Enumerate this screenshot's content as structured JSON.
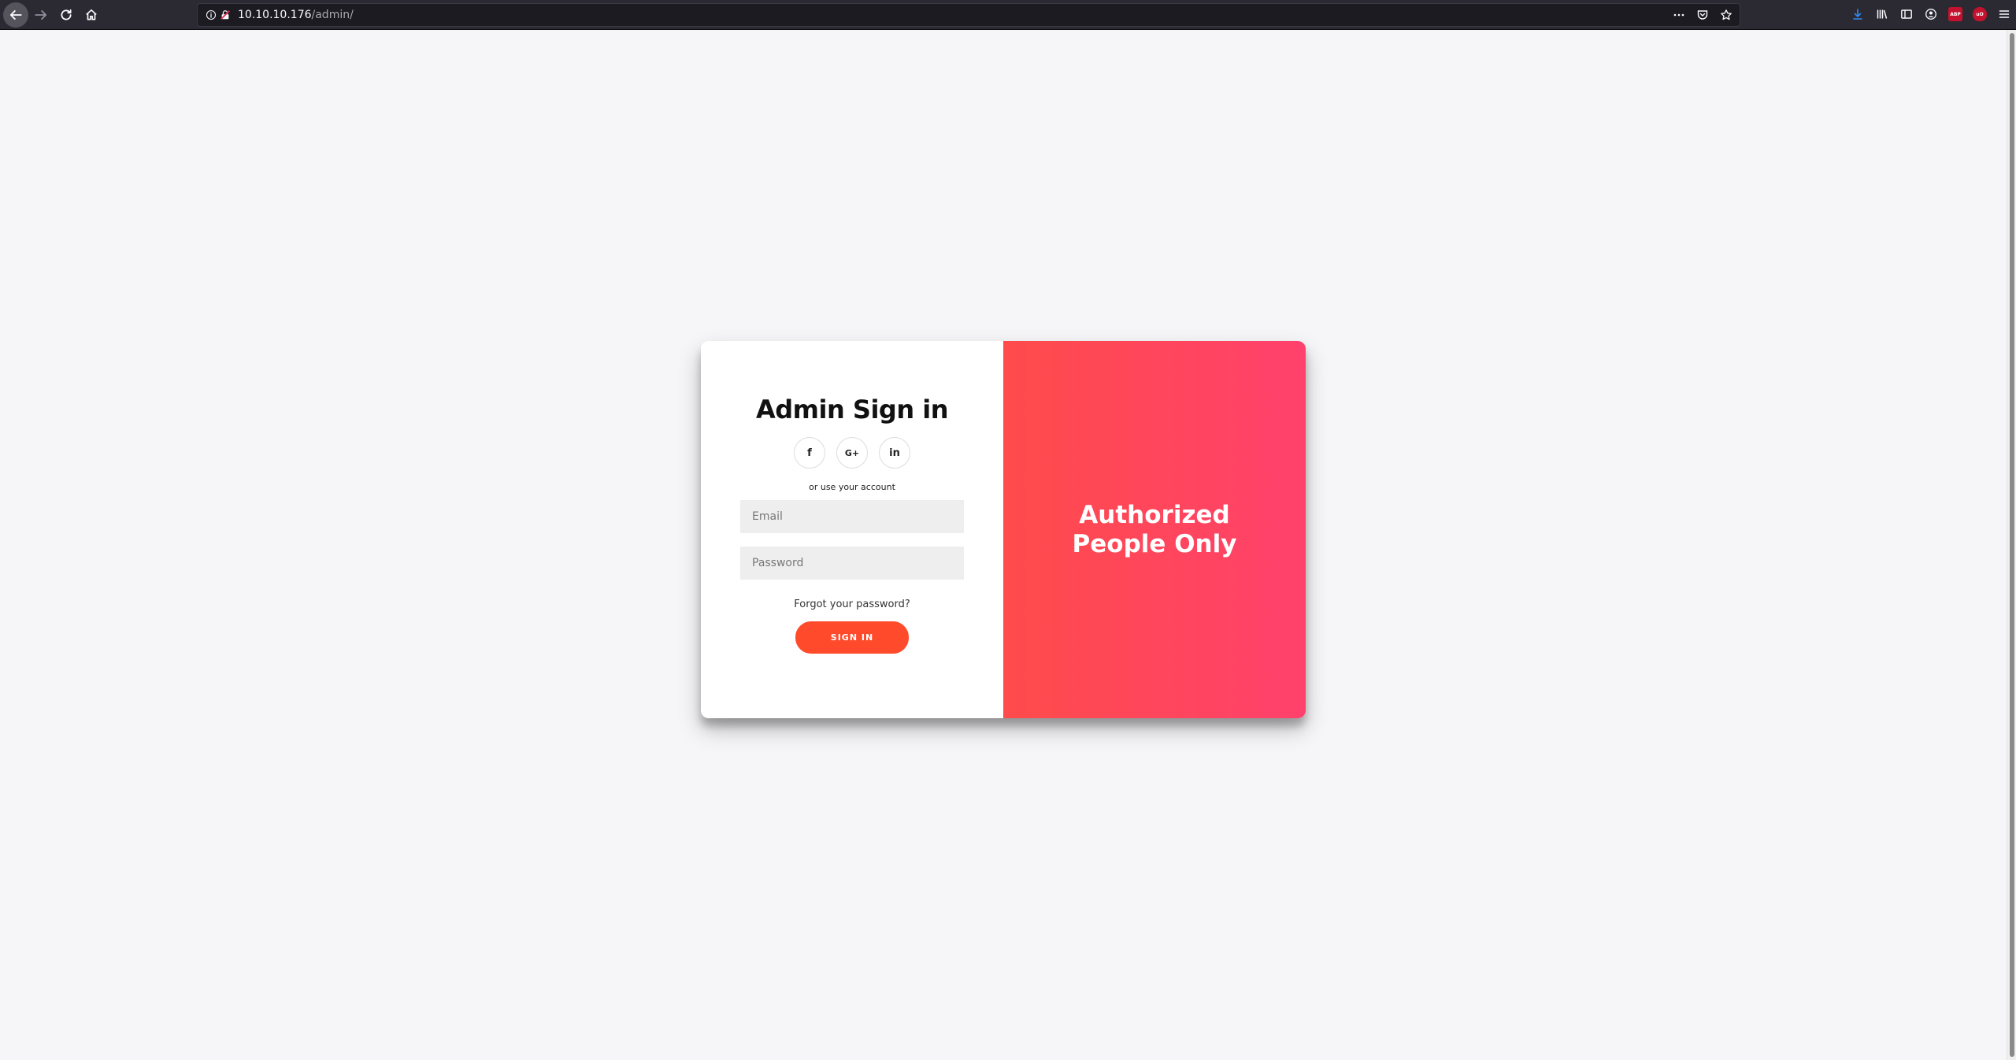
{
  "browser": {
    "url_host": "10.10.10.176",
    "url_path": "/admin/",
    "ext_abp": "ABP",
    "ext_ublock": "uO"
  },
  "login": {
    "title": "Admin Sign in",
    "social": {
      "facebook": "f",
      "google": "G+",
      "linkedin": "in"
    },
    "or_text": "or use your account",
    "email_placeholder": "Email",
    "password_placeholder": "Password",
    "forgot_label": "Forgot your password?",
    "signin_label": "SIGN IN"
  },
  "overlay": {
    "title": "Authorized People Only"
  },
  "colors": {
    "accent": "#ff4b2b",
    "gradient_start": "#ff4b4b",
    "gradient_end": "#ff416c",
    "page_bg": "#f6f6f8"
  }
}
